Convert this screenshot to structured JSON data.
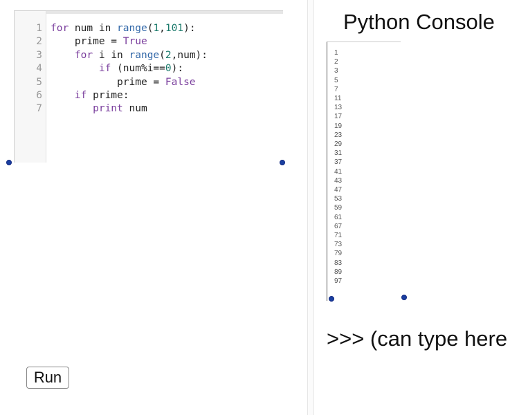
{
  "editor": {
    "lines": [
      {
        "num": "1",
        "segments": [
          {
            "t": "for",
            "c": "kw"
          },
          {
            "t": " num in "
          },
          {
            "t": "range",
            "c": "bi"
          },
          {
            "t": "("
          },
          {
            "t": "1",
            "c": "num"
          },
          {
            "t": ","
          },
          {
            "t": "101",
            "c": "num"
          },
          {
            "t": "):"
          }
        ]
      },
      {
        "num": "2",
        "segments": [
          {
            "t": "    prime = "
          },
          {
            "t": "True",
            "c": "bool"
          }
        ]
      },
      {
        "num": "3",
        "segments": [
          {
            "t": "    "
          },
          {
            "t": "for",
            "c": "kw"
          },
          {
            "t": " i in "
          },
          {
            "t": "range",
            "c": "bi"
          },
          {
            "t": "("
          },
          {
            "t": "2",
            "c": "num"
          },
          {
            "t": ",num):"
          }
        ]
      },
      {
        "num": "4",
        "segments": [
          {
            "t": "        "
          },
          {
            "t": "if",
            "c": "kw"
          },
          {
            "t": " (num%i=="
          },
          {
            "t": "0",
            "c": "num"
          },
          {
            "t": "):"
          }
        ]
      },
      {
        "num": "5",
        "segments": [
          {
            "t": "           prime = "
          },
          {
            "t": "False",
            "c": "bool"
          }
        ]
      },
      {
        "num": "6",
        "segments": [
          {
            "t": "    "
          },
          {
            "t": "if",
            "c": "kw"
          },
          {
            "t": " prime:"
          }
        ]
      },
      {
        "num": "7",
        "segments": [
          {
            "t": "       "
          },
          {
            "t": "print",
            "c": "kw"
          },
          {
            "t": " num"
          }
        ]
      }
    ]
  },
  "run_button": {
    "label": "Run"
  },
  "console": {
    "title": "Python Console",
    "output": [
      "1",
      "2",
      "3",
      "5",
      "7",
      "11",
      "13",
      "17",
      "19",
      "23",
      "29",
      "31",
      "37",
      "41",
      "43",
      "47",
      "53",
      "59",
      "61",
      "67",
      "71",
      "73",
      "79",
      "83",
      "89",
      "97"
    ],
    "prompt": ">>>  (can type here"
  }
}
